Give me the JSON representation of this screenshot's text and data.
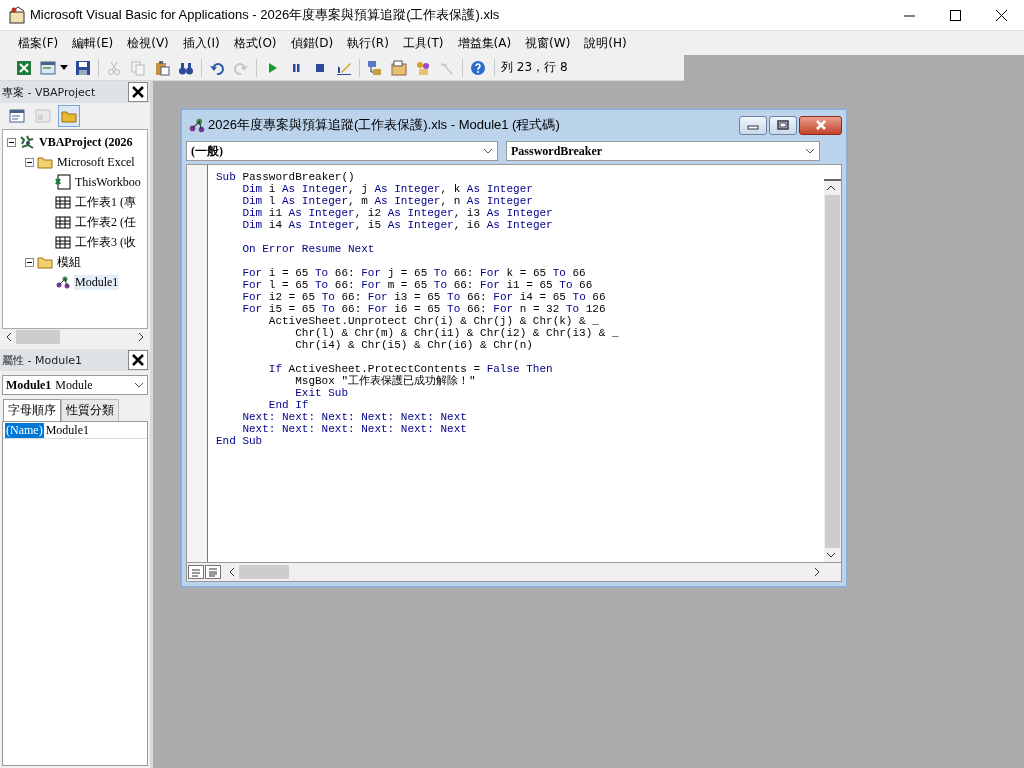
{
  "window": {
    "title": "Microsoft Visual Basic for Applications - 2026年度專案與預算追蹤(工作表保護).xls"
  },
  "menu": [
    "檔案(F)",
    "編輯(E)",
    "檢視(V)",
    "插入(I)",
    "格式(O)",
    "偵錯(D)",
    "執行(R)",
    "工具(T)",
    "增益集(A)",
    "視窗(W)",
    "說明(H)"
  ],
  "toolbar": [
    {
      "kind": "excel",
      "disabled": false
    },
    {
      "kind": "userform",
      "disabled": false
    },
    {
      "kind": "dropdown",
      "disabled": false
    },
    {
      "kind": "save",
      "disabled": false
    },
    {
      "kind": "separator"
    },
    {
      "kind": "cut",
      "disabled": true
    },
    {
      "kind": "copy",
      "disabled": true
    },
    {
      "kind": "paste",
      "disabled": false
    },
    {
      "kind": "find",
      "disabled": false
    },
    {
      "kind": "separator"
    },
    {
      "kind": "undo",
      "disabled": false
    },
    {
      "kind": "redo",
      "disabled": true
    },
    {
      "kind": "separator"
    },
    {
      "kind": "run",
      "disabled": false
    },
    {
      "kind": "pause",
      "disabled": false
    },
    {
      "kind": "stop",
      "disabled": false
    },
    {
      "kind": "design",
      "disabled": false
    },
    {
      "kind": "separator"
    },
    {
      "kind": "explorer",
      "disabled": false
    },
    {
      "kind": "properties",
      "disabled": false
    },
    {
      "kind": "browser",
      "disabled": false
    },
    {
      "kind": "toolbox",
      "disabled": true
    },
    {
      "kind": "separator"
    },
    {
      "kind": "help",
      "disabled": false
    }
  ],
  "position": "列 23，行 8",
  "project_pane": {
    "title": "專案 - VBAProject",
    "toolbar": [
      {
        "kind": "view-code",
        "disabled": false,
        "selected": false
      },
      {
        "kind": "view-object",
        "disabled": true,
        "selected": false
      },
      {
        "kind": "folders",
        "disabled": false,
        "selected": true
      }
    ],
    "tree": [
      {
        "label": "VBAProject (2026",
        "kind": "project",
        "expanded": true,
        "selected": false,
        "children": [
          {
            "label": "Microsoft Excel",
            "kind": "folder",
            "expanded": true,
            "selected": false,
            "children": [
              {
                "label": "ThisWorkboo",
                "kind": "workbook",
                "selected": false
              },
              {
                "label": "工作表1 (專",
                "kind": "sheet",
                "selected": false
              },
              {
                "label": "工作表2 (任",
                "kind": "sheet",
                "selected": false
              },
              {
                "label": "工作表3 (收",
                "kind": "sheet",
                "selected": false
              }
            ]
          },
          {
            "label": "模組",
            "kind": "folder",
            "expanded": true,
            "selected": false,
            "children": [
              {
                "label": "Module1",
                "kind": "module",
                "selected": true
              }
            ]
          }
        ]
      }
    ]
  },
  "properties_pane": {
    "title": "屬性 - Module1",
    "object_name": "Module1",
    "object_type": "Module",
    "tabs": [
      {
        "label": "字母順序",
        "selected": true
      },
      {
        "label": "性質分類",
        "selected": false
      }
    ],
    "rows": [
      {
        "name": "(Name)",
        "value": "Module1",
        "selected": true
      }
    ]
  },
  "code_window": {
    "title": "2026年度專案與預算追蹤(工作表保護).xls - Module1 (程式碼)",
    "object_box": "(一般)",
    "procedure_box": "PasswordBreaker",
    "lines": [
      {
        "kind": "code",
        "segments": [
          {
            "kind": "keyword",
            "text": "Sub"
          },
          {
            "kind": "plain",
            "text": " PasswordBreaker()"
          }
        ],
        "children": [
          {
            "kind": "code",
            "segments": [
              {
                "kind": "keyword",
                "text": "Dim"
              },
              {
                "kind": "plain",
                "text": " i "
              },
              {
                "kind": "keyword",
                "text": "As Integer"
              },
              {
                "kind": "plain",
                "text": ", j "
              },
              {
                "kind": "keyword",
                "text": "As Integer"
              },
              {
                "kind": "plain",
                "text": ", k "
              },
              {
                "kind": "keyword",
                "text": "As Integer"
              }
            ]
          },
          {
            "kind": "code",
            "segments": [
              {
                "kind": "keyword",
                "text": "Dim"
              },
              {
                "kind": "plain",
                "text": " l "
              },
              {
                "kind": "keyword",
                "text": "As Integer"
              },
              {
                "kind": "plain",
                "text": ", m "
              },
              {
                "kind": "keyword",
                "text": "As Integer"
              },
              {
                "kind": "plain",
                "text": ", n "
              },
              {
                "kind": "keyword",
                "text": "As Integer"
              }
            ]
          },
          {
            "kind": "code",
            "segments": [
              {
                "kind": "keyword",
                "text": "Dim"
              },
              {
                "kind": "plain",
                "text": " i1 "
              },
              {
                "kind": "keyword",
                "text": "As Integer"
              },
              {
                "kind": "plain",
                "text": ", i2 "
              },
              {
                "kind": "keyword",
                "text": "As Integer"
              },
              {
                "kind": "plain",
                "text": ", i3 "
              },
              {
                "kind": "keyword",
                "text": "As Integer"
              }
            ]
          },
          {
            "kind": "code",
            "segments": [
              {
                "kind": "keyword",
                "text": "Dim"
              },
              {
                "kind": "plain",
                "text": " i4 "
              },
              {
                "kind": "keyword",
                "text": "As Integer"
              },
              {
                "kind": "plain",
                "text": ", i5 "
              },
              {
                "kind": "keyword",
                "text": "As Integer"
              },
              {
                "kind": "plain",
                "text": ", i6 "
              },
              {
                "kind": "keyword",
                "text": "As Integer"
              }
            ]
          },
          {
            "kind": "blank"
          },
          {
            "kind": "code",
            "segments": [
              {
                "kind": "keyword",
                "text": "On Error Resume Next"
              }
            ]
          },
          {
            "kind": "blank"
          },
          {
            "kind": "code",
            "segments": [
              {
                "kind": "keyword",
                "text": "For"
              },
              {
                "kind": "plain",
                "text": " i = 65 "
              },
              {
                "kind": "keyword",
                "text": "To"
              },
              {
                "kind": "plain",
                "text": " 66: "
              },
              {
                "kind": "keyword",
                "text": "For"
              },
              {
                "kind": "plain",
                "text": " j = 65 "
              },
              {
                "kind": "keyword",
                "text": "To"
              },
              {
                "kind": "plain",
                "text": " 66: "
              },
              {
                "kind": "keyword",
                "text": "For"
              },
              {
                "kind": "plain",
                "text": " k = 65 "
              },
              {
                "kind": "keyword",
                "text": "To"
              },
              {
                "kind": "plain",
                "text": " 66"
              }
            ]
          },
          {
            "kind": "code",
            "segments": [
              {
                "kind": "keyword",
                "text": "For"
              },
              {
                "kind": "plain",
                "text": " l = 65 "
              },
              {
                "kind": "keyword",
                "text": "To"
              },
              {
                "kind": "plain",
                "text": " 66: "
              },
              {
                "kind": "keyword",
                "text": "For"
              },
              {
                "kind": "plain",
                "text": " m = 65 "
              },
              {
                "kind": "keyword",
                "text": "To"
              },
              {
                "kind": "plain",
                "text": " 66: "
              },
              {
                "kind": "keyword",
                "text": "For"
              },
              {
                "kind": "plain",
                "text": " i1 = 65 "
              },
              {
                "kind": "keyword",
                "text": "To"
              },
              {
                "kind": "plain",
                "text": " 66"
              }
            ]
          },
          {
            "kind": "code",
            "segments": [
              {
                "kind": "keyword",
                "text": "For"
              },
              {
                "kind": "plain",
                "text": " i2 = 65 "
              },
              {
                "kind": "keyword",
                "text": "To"
              },
              {
                "kind": "plain",
                "text": " 66: "
              },
              {
                "kind": "keyword",
                "text": "For"
              },
              {
                "kind": "plain",
                "text": " i3 = 65 "
              },
              {
                "kind": "keyword",
                "text": "To"
              },
              {
                "kind": "plain",
                "text": " 66: "
              },
              {
                "kind": "keyword",
                "text": "For"
              },
              {
                "kind": "plain",
                "text": " i4 = 65 "
              },
              {
                "kind": "keyword",
                "text": "To"
              },
              {
                "kind": "plain",
                "text": " 66"
              }
            ]
          },
          {
            "kind": "code",
            "segments": [
              {
                "kind": "keyword",
                "text": "For"
              },
              {
                "kind": "plain",
                "text": " i5 = 65 "
              },
              {
                "kind": "keyword",
                "text": "To"
              },
              {
                "kind": "plain",
                "text": " 66: "
              },
              {
                "kind": "keyword",
                "text": "For"
              },
              {
                "kind": "plain",
                "text": " i6 = 65 "
              },
              {
                "kind": "keyword",
                "text": "To"
              },
              {
                "kind": "plain",
                "text": " 66: "
              },
              {
                "kind": "keyword",
                "text": "For"
              },
              {
                "kind": "plain",
                "text": " n = 32 "
              },
              {
                "kind": "keyword",
                "text": "To"
              },
              {
                "kind": "plain",
                "text": " 126"
              }
            ],
            "children": [
              {
                "kind": "code",
                "segments": [
                  {
                    "kind": "plain",
                    "text": "ActiveSheet.Unprotect Chr(i) & Chr(j) & Chr(k) & _"
                  }
                ],
                "children": [
                  {
                    "kind": "code",
                    "segments": [
                      {
                        "kind": "plain",
                        "text": "Chr(l) & Chr(m) & Chr(i1) & Chr(i2) & Chr(i3) & _"
                      }
                    ]
                  },
                  {
                    "kind": "code",
                    "segments": [
                      {
                        "kind": "plain",
                        "text": "Chr(i4) & Chr(i5) & Chr(i6) & Chr(n)"
                      }
                    ]
                  }
                ]
              },
              {
                "kind": "blank"
              },
              {
                "kind": "code",
                "segments": [
                  {
                    "kind": "keyword",
                    "text": "If"
                  },
                  {
                    "kind": "plain",
                    "text": " ActiveSheet.ProtectContents = "
                  },
                  {
                    "kind": "keyword",
                    "text": "False Then"
                  }
                ],
                "children": [
                  {
                    "kind": "code",
                    "segments": [
                      {
                        "kind": "plain",
                        "text": "MsgBox \"工作表保護已成功解除！\""
                      }
                    ]
                  },
                  {
                    "kind": "code",
                    "segments": [
                      {
                        "kind": "keyword",
                        "text": "Exit Sub"
                      }
                    ]
                  }
                ]
              },
              {
                "kind": "code",
                "segments": [
                  {
                    "kind": "keyword",
                    "text": "End If"
                  }
                ]
              }
            ]
          },
          {
            "kind": "code",
            "segments": [
              {
                "kind": "keyword",
                "text": "Next: Next: Next: Next: Next: Next"
              }
            ]
          },
          {
            "kind": "code",
            "segments": [
              {
                "kind": "keyword",
                "text": "Next: Next: Next: Next: Next: Next"
              }
            ]
          }
        ]
      },
      {
        "kind": "code",
        "segments": [
          {
            "kind": "keyword",
            "text": "End Sub"
          }
        ]
      }
    ]
  }
}
